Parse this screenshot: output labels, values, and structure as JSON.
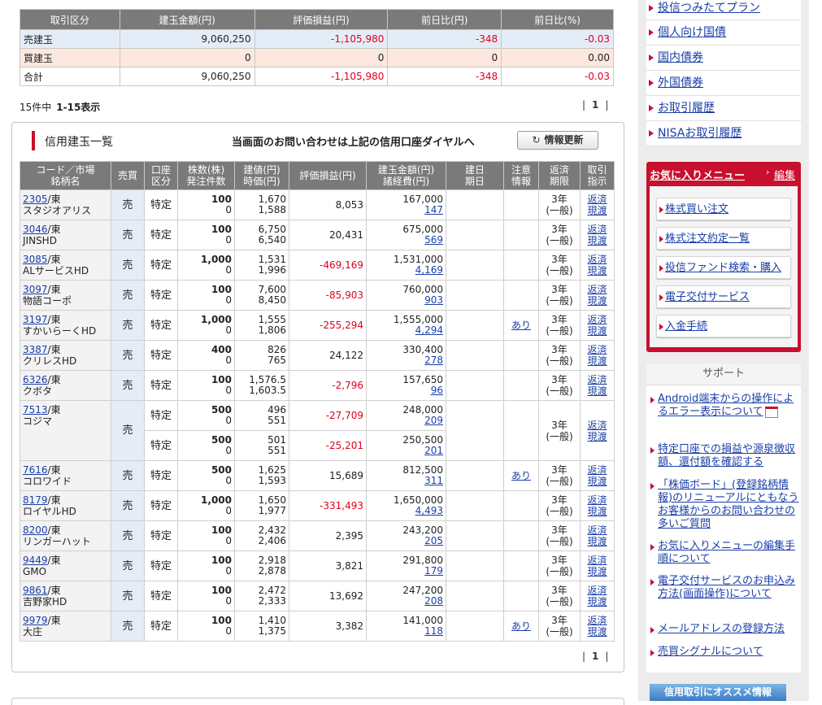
{
  "summary": {
    "headers": [
      "取引区分",
      "建玉金額(円)",
      "評価損益(円)",
      "前日比(円)",
      "前日比(%)"
    ],
    "rows": [
      {
        "label": "売建玉",
        "amount": "9,060,250",
        "pnl": "-1,105,980",
        "diff": "-348",
        "pct": "-0.03"
      },
      {
        "label": "買建玉",
        "amount": "0",
        "pnl": "0",
        "diff": "0",
        "pct": "0.00"
      },
      {
        "label": "合計",
        "amount": "9,060,250",
        "pnl": "-1,105,980",
        "diff": "-348",
        "pct": "-0.03"
      }
    ]
  },
  "count": {
    "total": "15件中",
    "range": "1-15表示"
  },
  "pager": {
    "page": "1"
  },
  "panel": {
    "title": "信用建玉一覧",
    "note": "当画面のお問い合わせは上記の信用口座ダイヤルへ",
    "refresh": "情報更新",
    "refresh_icon": "refresh-icon"
  },
  "columns": [
    [
      "コード／市場",
      "銘柄名"
    ],
    [
      "売買"
    ],
    [
      "口座",
      "区分"
    ],
    [
      "株数(株)",
      "発注件数"
    ],
    [
      "建値(円)",
      "時価(円)"
    ],
    [
      "評価損益(円)"
    ],
    [
      "建玉金額(円)",
      "諸経費(円)"
    ],
    [
      "建日",
      "期日"
    ],
    [
      "注意",
      "情報"
    ],
    [
      "返済",
      "期限"
    ],
    [
      "取引",
      "指示"
    ]
  ],
  "positions": [
    {
      "code": "2305",
      "market": "/東",
      "name": "スタジオアリス",
      "side": "売",
      "acct": "特定",
      "qty": "100",
      "orders": "0",
      "price": "1,670",
      "current": "1,588",
      "pnl": "8,053",
      "amount": "167,000",
      "fee": "147",
      "note": "",
      "period": [
        "3年",
        "(一般)"
      ],
      "act": [
        "返済",
        "現渡"
      ]
    },
    {
      "code": "3046",
      "market": "/東",
      "name": "JINSHD",
      "side": "売",
      "acct": "特定",
      "qty": "100",
      "orders": "0",
      "price": "6,750",
      "current": "6,540",
      "pnl": "20,431",
      "amount": "675,000",
      "fee": "569",
      "note": "",
      "period": [
        "3年",
        "(一般)"
      ],
      "act": [
        "返済",
        "現渡"
      ]
    },
    {
      "code": "3085",
      "market": "/東",
      "name": "ALサービスHD",
      "side": "売",
      "acct": "特定",
      "qty": "1,000",
      "orders": "0",
      "price": "1,531",
      "current": "1,996",
      "pnl": "-469,169",
      "amount": "1,531,000",
      "fee": "4,169",
      "note": "",
      "period": [
        "3年",
        "(一般)"
      ],
      "act": [
        "返済",
        "現渡"
      ]
    },
    {
      "code": "3097",
      "market": "/東",
      "name": "物語コーポ",
      "side": "売",
      "acct": "特定",
      "qty": "100",
      "orders": "0",
      "price": "7,600",
      "current": "8,450",
      "pnl": "-85,903",
      "amount": "760,000",
      "fee": "903",
      "note": "",
      "period": [
        "3年",
        "(一般)"
      ],
      "act": [
        "返済",
        "現渡"
      ]
    },
    {
      "code": "3197",
      "market": "/東",
      "name": "すかいらーくHD",
      "side": "売",
      "acct": "特定",
      "qty": "1,000",
      "orders": "0",
      "price": "1,555",
      "current": "1,806",
      "pnl": "-255,294",
      "amount": "1,555,000",
      "fee": "4,294",
      "note": "あり",
      "period": [
        "3年",
        "(一般)"
      ],
      "act": [
        "返済",
        "現渡"
      ]
    },
    {
      "code": "3387",
      "market": "/東",
      "name": "クリレスHD",
      "side": "売",
      "acct": "特定",
      "qty": "400",
      "orders": "0",
      "price": "826",
      "current": "765",
      "pnl": "24,122",
      "amount": "330,400",
      "fee": "278",
      "note": "",
      "period": [
        "3年",
        "(一般)"
      ],
      "act": [
        "返済",
        "現渡"
      ]
    },
    {
      "code": "6326",
      "market": "/東",
      "name": "クボタ",
      "side": "売",
      "acct": "特定",
      "qty": "100",
      "orders": "0",
      "price": "1,576.5",
      "current": "1,603.5",
      "pnl": "-2,796",
      "amount": "157,650",
      "fee": "96",
      "note": "",
      "period": [
        "3年",
        "(一般)"
      ],
      "act": [
        "返済",
        "現渡"
      ]
    },
    {
      "code": "7513",
      "market": "/東",
      "name": "コジマ",
      "side": "売",
      "acct": "特定",
      "qty": "500",
      "orders": "0",
      "price": "496",
      "current": "551",
      "pnl": "-27,709",
      "amount": "248,000",
      "fee": "209",
      "acct2": "特定",
      "qty2": "500",
      "orders2": "0",
      "price2": "501",
      "current2": "551",
      "pnl2": "-25,201",
      "amount2": "250,500",
      "fee2": "201",
      "note": "",
      "period": [
        "3年",
        "(一般)"
      ],
      "act": [
        "返済",
        "現渡"
      ]
    },
    {
      "code": "7616",
      "market": "/東",
      "name": "コロワイド",
      "side": "売",
      "acct": "特定",
      "qty": "500",
      "orders": "0",
      "price": "1,625",
      "current": "1,593",
      "pnl": "15,689",
      "amount": "812,500",
      "fee": "311",
      "note": "あり",
      "period": [
        "3年",
        "(一般)"
      ],
      "act": [
        "返済",
        "現渡"
      ]
    },
    {
      "code": "8179",
      "market": "/東",
      "name": "ロイヤルHD",
      "side": "売",
      "acct": "特定",
      "qty": "1,000",
      "orders": "0",
      "price": "1,650",
      "current": "1,977",
      "pnl": "-331,493",
      "amount": "1,650,000",
      "fee": "4,493",
      "note": "",
      "period": [
        "3年",
        "(一般)"
      ],
      "act": [
        "返済",
        "現渡"
      ]
    },
    {
      "code": "8200",
      "market": "/東",
      "name": "リンガーハット",
      "side": "売",
      "acct": "特定",
      "qty": "100",
      "orders": "0",
      "price": "2,432",
      "current": "2,406",
      "pnl": "2,395",
      "amount": "243,200",
      "fee": "205",
      "note": "",
      "period": [
        "3年",
        "(一般)"
      ],
      "act": [
        "返済",
        "現渡"
      ]
    },
    {
      "code": "9449",
      "market": "/東",
      "name": "GMO",
      "side": "売",
      "acct": "特定",
      "qty": "100",
      "orders": "0",
      "price": "2,918",
      "current": "2,878",
      "pnl": "3,821",
      "amount": "291,800",
      "fee": "179",
      "note": "",
      "period": [
        "3年",
        "(一般)"
      ],
      "act": [
        "返済",
        "現渡"
      ]
    },
    {
      "code": "9861",
      "market": "/東",
      "name": "吉野家HD",
      "side": "売",
      "acct": "特定",
      "qty": "100",
      "orders": "0",
      "price": "2,472",
      "current": "2,333",
      "pnl": "13,692",
      "amount": "247,200",
      "fee": "208",
      "note": "",
      "period": [
        "3年",
        "(一般)"
      ],
      "act": [
        "返済",
        "現渡"
      ]
    },
    {
      "code": "9979",
      "market": "/東",
      "name": "大庄",
      "side": "売",
      "acct": "特定",
      "qty": "100",
      "orders": "0",
      "price": "1,410",
      "current": "1,375",
      "pnl": "3,382",
      "amount": "141,000",
      "fee": "118",
      "note": "あり",
      "period": [
        "3年",
        "(一般)"
      ],
      "act": [
        "返済",
        "現渡"
      ]
    }
  ],
  "sidebar": {
    "links": [
      "投信つみたてプラン",
      "個人向け国債",
      "国内債券",
      "外国債券",
      "お取引履歴",
      "NISAお取引履歴"
    ],
    "fav": {
      "title": "お気に入りメニュー",
      "edit": "編集",
      "items": [
        "株式買い注文",
        "株式注文約定一覧",
        "投信ファンド検索・購入",
        "電子交付サービス",
        "入金手続"
      ]
    },
    "support": {
      "title": "サポート",
      "items": [
        "Android端末からの操作によるエラー表示について",
        "特定口座での損益や源泉徴収額、還付額を確認する",
        "「株価ボード」(登録銘柄情報)のリニューアルにともなうお客様からのお問い合わせの多いご質問",
        "お気に入りメニューの編集手順について",
        "電子交付サービスのお申込み方法(画面操作)について",
        "メールアドレスの登録方法",
        "売買シグナルについて"
      ]
    },
    "banner": "信用取引にオススメ情報"
  },
  "colors": {
    "accent": "#c8102e",
    "header": "#7a7a7a",
    "link": "#1a3ea8",
    "negative": "#e0001b",
    "sell_bg": "#e4edf7",
    "buy_bg": "#fce8de"
  }
}
